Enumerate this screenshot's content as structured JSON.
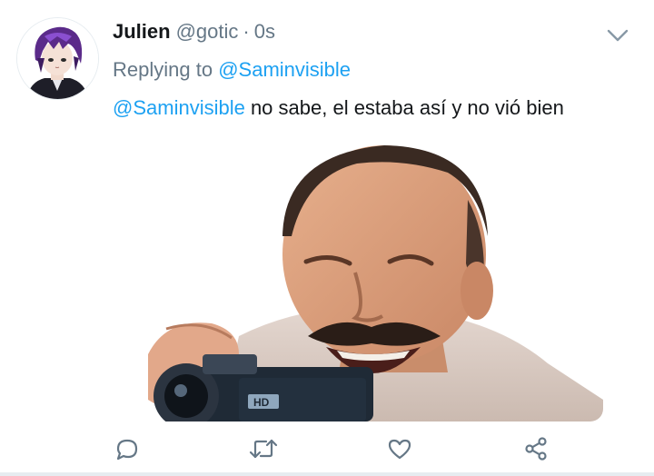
{
  "tweet": {
    "author_name": "Julien",
    "author_handle": "@gotic",
    "separator": "·",
    "timestamp": "0s",
    "replying_prefix": "Replying to",
    "replying_to": "@Saminvisible",
    "text_mention": "@Saminvisible",
    "text_body": " no sabe, el estaba así y no vió bien"
  },
  "icons": {
    "menu": "chevron-down-icon",
    "reply": "reply-icon",
    "retweet": "retweet-icon",
    "like": "heart-icon",
    "share": "share-icon"
  },
  "colors": {
    "text": "#14171a",
    "secondary": "#657786",
    "link": "#1da1f2",
    "icon": "#657786"
  }
}
